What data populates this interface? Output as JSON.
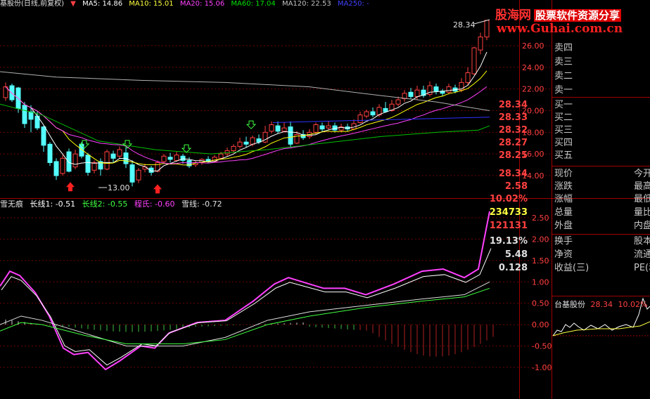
{
  "header": {
    "title": "基股份(日线,前复权)",
    "ma5": "MA5: 14.86",
    "ma10": "MA10: 15.01",
    "ma20": "MA20: 15.06",
    "ma60": "MA60: 17.04",
    "ma120": "MA120: 22.53",
    "ma250": "MA250: -"
  },
  "logo": {
    "line1": "股海网",
    "line1b": "股票软件资源分享",
    "line2": "www.Guhai.com.cn"
  },
  "annotations": {
    "high": "28.34",
    "low": "13.00"
  },
  "price_axis": [
    "26.00",
    "24.00",
    "22.00",
    "20.00",
    "18.00",
    "16.00",
    "14.00"
  ],
  "indicator": {
    "name": "雪无痕",
    "l1": "长线1: -0.51",
    "l2": "长线2: -0.55",
    "l3": "程氏: -0.60",
    "l4": "雪线: -0.72"
  },
  "ind_axis": [
    "2.50",
    "2.00",
    "1.50",
    "1.00",
    "0.50",
    "0.00",
    "-0.50",
    "-1.00"
  ],
  "quote": {
    "sell": [
      {
        "label": "卖四"
      },
      {
        "label": "卖三"
      },
      {
        "label": "卖二"
      },
      {
        "label": "卖一"
      }
    ],
    "buy": [
      {
        "label": "买一",
        "value": "28.34"
      },
      {
        "label": "买二",
        "value": "28.33"
      },
      {
        "label": "买三",
        "value": "28.32"
      },
      {
        "label": "买四",
        "value": "28.27"
      },
      {
        "label": "买五",
        "value": "28.25"
      }
    ],
    "stats": [
      {
        "label": "现价",
        "value": "28.34",
        "extra": "今开"
      },
      {
        "label": "涨跌",
        "value": "2.58",
        "extra": "最高"
      },
      {
        "label": "涨幅",
        "value": "10.02%",
        "extra": "最低"
      },
      {
        "label": "总量",
        "value": "234733",
        "extra": "量比"
      },
      {
        "label": "外盘",
        "value": "121131",
        "extra": "内盘"
      },
      {
        "label": "换手",
        "value": "19.13%",
        "extra": "股本"
      },
      {
        "label": "净资",
        "value": "5.48",
        "extra": "流通"
      },
      {
        "label": "收益(三)",
        "value": "0.128",
        "extra": "PE(动)"
      }
    ]
  },
  "mini": {
    "name": "台基股份",
    "price": "28.34",
    "pct": "10.02%"
  },
  "colors": {
    "up": "#ff4040",
    "down": "#54ffff",
    "ma5": "#ffffff",
    "ma10": "#ffff00",
    "ma20": "#ff40ff",
    "ma60": "#00c000",
    "ma120": "#b0b0b0",
    "grid": "#8b0000"
  }
}
